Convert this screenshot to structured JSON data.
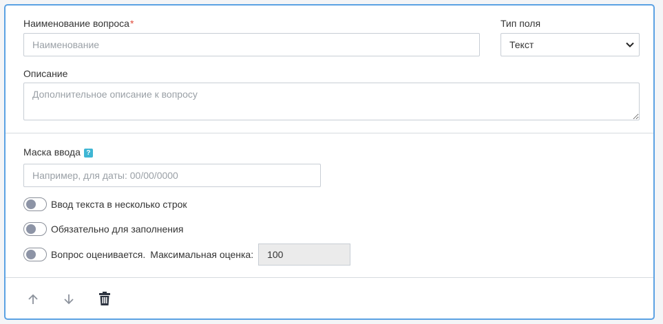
{
  "question": {
    "name_label": "Наименование вопроса",
    "required_mark": "*",
    "name_placeholder": "Наименование",
    "name_value": "",
    "field_type_label": "Тип поля",
    "field_type_value": "Текст",
    "description_label": "Описание",
    "description_placeholder": "Дополнительное описание к вопросу",
    "description_value": ""
  },
  "mask": {
    "label": "Маска ввода",
    "help_icon": "?",
    "placeholder": "Например, для даты: 00/00/0000",
    "value": ""
  },
  "toggles": [
    {
      "label": "Ввод текста в несколько строк",
      "on": false
    },
    {
      "label": "Обязательно для заполнения",
      "on": false
    },
    {
      "label": "Вопрос оценивается.",
      "on": false
    }
  ],
  "score": {
    "label": "Максимальная оценка:",
    "value": "100"
  },
  "footer": {
    "icons": [
      "arrow-up-icon",
      "arrow-down-icon",
      "trash-icon"
    ]
  },
  "colors": {
    "accent_border": "#5aa1e3",
    "required": "#e04b3c",
    "help": "#3fb6d4",
    "toggle_knob": "#8d94a6"
  }
}
